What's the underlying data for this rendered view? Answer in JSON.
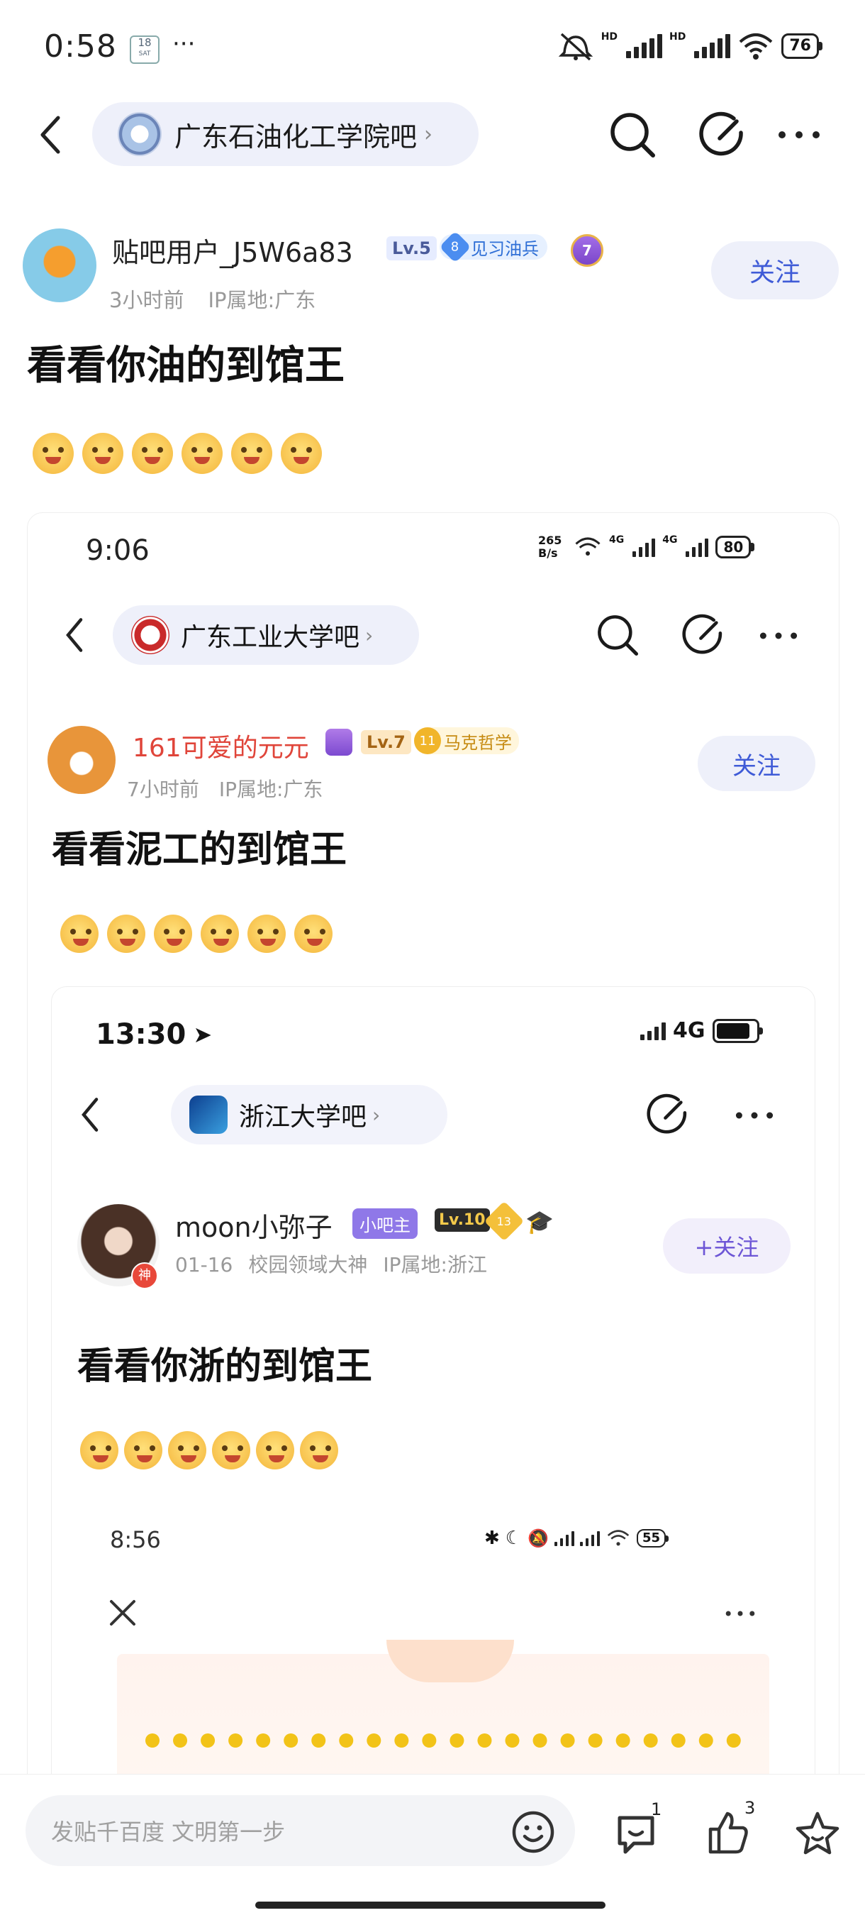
{
  "status": {
    "time": "0:58",
    "calendar_day": "18",
    "calendar_weekday": "SAT",
    "more": "···",
    "hd1": "HD",
    "hd2": "HD",
    "battery": "76"
  },
  "nav": {
    "forum_name": "广东石油化工学院吧"
  },
  "post": {
    "username": "贴吧用户_J5W6a83",
    "level": "Lv.5",
    "title_badge_num": "8",
    "title_badge_text": "见习油兵",
    "medal_num": "7",
    "time": "3小时前",
    "ip": "IP属地:广东",
    "follow_label": "关注",
    "title": "看看你油的到馆王"
  },
  "nested1": {
    "time": "9:06",
    "net_speed": "265 B/s",
    "net1": "4G",
    "net2": "4G",
    "battery": "80",
    "forum_name": "广东工业大学吧",
    "username": "161可爱的元元",
    "level": "Lv.7",
    "badge_num": "11",
    "badge_text": "马克哲学",
    "time_ago": "7小时前",
    "ip": "IP属地:广东",
    "follow_label": "关注",
    "title": "看看泥工的到馆王"
  },
  "nested2": {
    "time": "13:30",
    "net": "4G",
    "forum_name": "浙江大学吧",
    "username": "moon小弥子",
    "mod_badge": "小吧主",
    "level": "Lv.10",
    "badge_num": "13",
    "avatar_tag": "神",
    "date": "01-16",
    "rank": "校园领域大神",
    "ip": "IP属地:浙江",
    "follow_label": "+关注",
    "title": "看看你浙的到馆王"
  },
  "nested3": {
    "time": "8:56",
    "battery": "55"
  },
  "bottom": {
    "placeholder": "发贴千百度 文明第一步",
    "comment_count": "1",
    "like_count": "3"
  },
  "colors": {
    "accent": "#3f5bd7",
    "pill_bg": "#eef0fa",
    "red_name": "#e0453a"
  }
}
